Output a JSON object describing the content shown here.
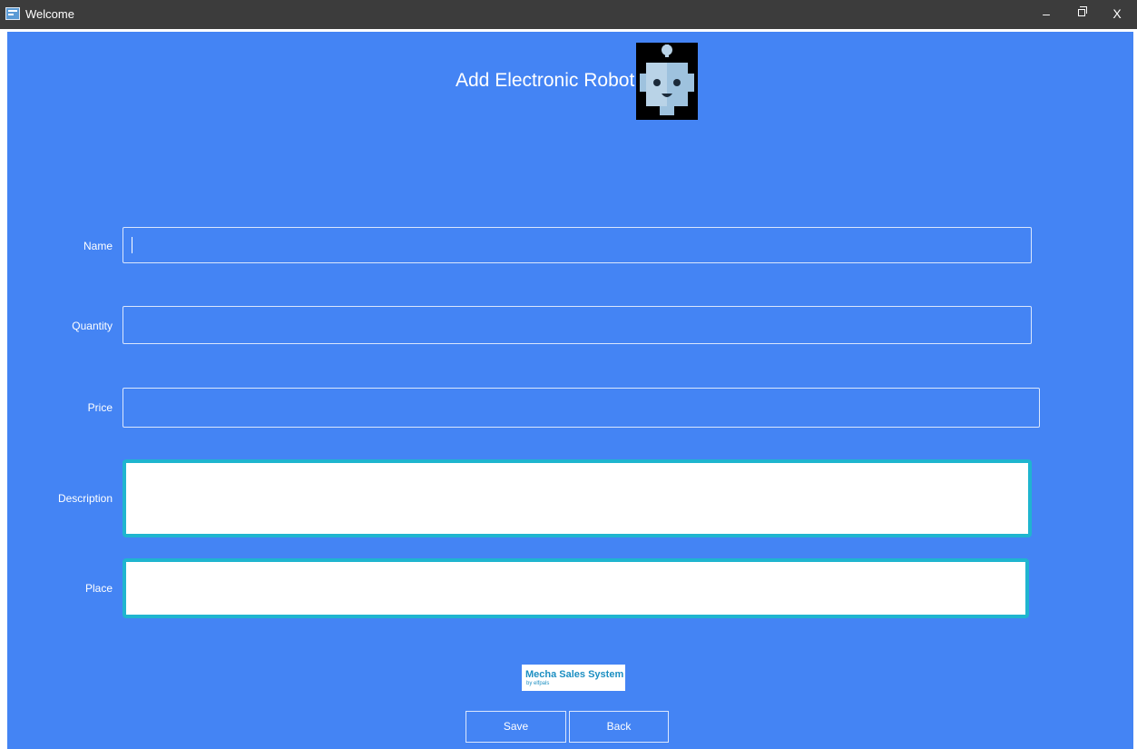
{
  "window": {
    "title": "Welcome",
    "controls": {
      "minimize": "–",
      "close": "X"
    }
  },
  "header": {
    "title": "Add Electronic Robot",
    "icon": "robot-icon"
  },
  "form": {
    "name_label": "Name",
    "name_value": "",
    "quantity_label": "Quantity",
    "quantity_value": "",
    "price_label": "Price",
    "price_value": "",
    "description_label": "Description",
    "description_value": "",
    "place_label": "Place",
    "place_value": ""
  },
  "logo": {
    "main": "Mecha Sales System",
    "sub": "by elfpals"
  },
  "buttons": {
    "save": "Save",
    "back": "Back"
  },
  "colors": {
    "background": "#4484f4",
    "titlebar": "#3c3c3c",
    "textarea_border": "#1fb5cf"
  }
}
